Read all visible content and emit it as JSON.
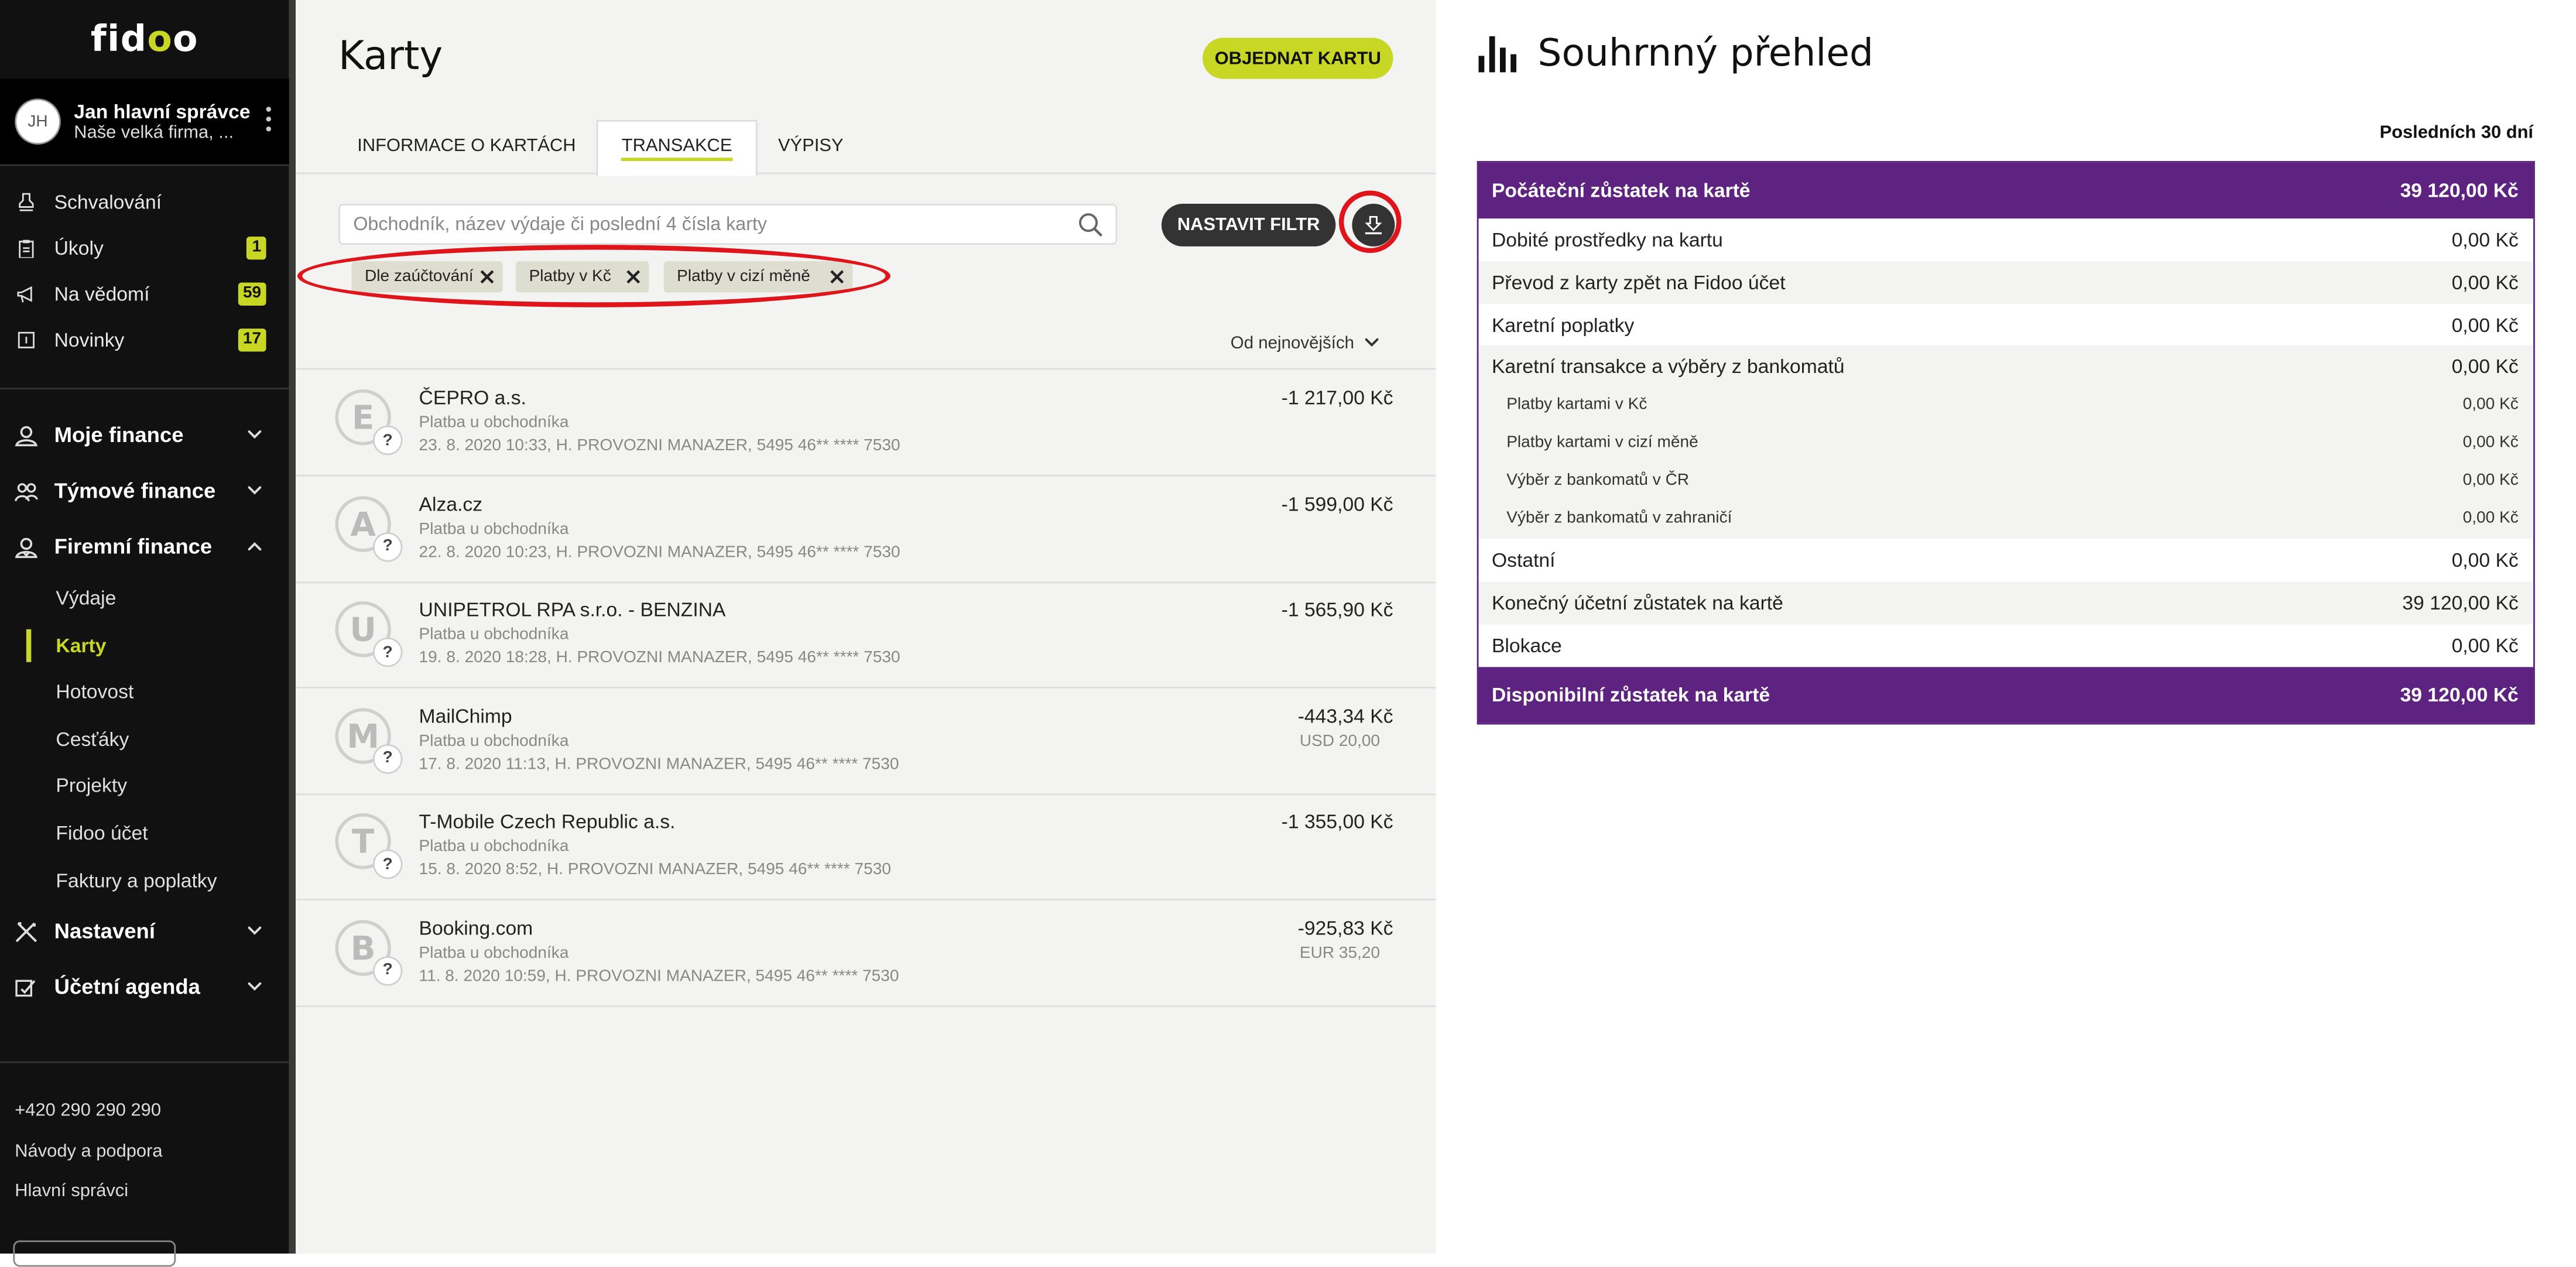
{
  "app": {
    "logo": "fidoo",
    "user_initials": "JH",
    "user_name": "Jan hlavní správce",
    "company": "Naše velká firma, ..."
  },
  "sidebar": {
    "items": [
      {
        "label": "Schvalování",
        "icon": "stamp-icon"
      },
      {
        "label": "Úkoly",
        "icon": "clipboard-icon",
        "badge": "1"
      },
      {
        "label": "Na vědomí",
        "icon": "megaphone-icon",
        "badge": "59"
      },
      {
        "label": "Novinky",
        "icon": "news-icon",
        "badge": "17"
      }
    ],
    "sections": [
      {
        "label": "Moje finance",
        "icon": "person-icon"
      },
      {
        "label": "Týmové finance",
        "icon": "team-icon"
      },
      {
        "label": "Firemní finance",
        "icon": "company-icon"
      }
    ],
    "sub_items": [
      "Výdaje",
      "Karty",
      "Hotovost",
      "Cesťáky",
      "Projekty",
      "Fidoo účet",
      "Faktury a poplatky"
    ],
    "active_sub": "Karty",
    "settings": {
      "label": "Nastavení",
      "icon": "tools-icon"
    },
    "accounting": {
      "label": "Účetní agenda",
      "icon": "accounting-icon"
    },
    "phone": "+420 290 290 290",
    "help": "Návody a podpora",
    "admins": "Hlavní správci"
  },
  "main": {
    "title": "Karty",
    "order_button": "OBJEDNAT KARTU",
    "tabs": [
      {
        "label": "INFORMACE O KARTÁCH"
      },
      {
        "label": "TRANSAKCE",
        "active": true
      },
      {
        "label": "VÝPISY"
      }
    ],
    "search_placeholder": "Obchodník, název výdaje či poslední 4 čísla karty",
    "filter_button": "NASTAVIT FILTR",
    "chips": [
      "Dle zaúčtování",
      "Platby v Kč",
      "Platby v cizí měně"
    ],
    "sort": "Od nejnovějších",
    "transactions": [
      {
        "initial": "E",
        "name": "ČEPRO a.s.",
        "type": "Platba u obchodníka",
        "detail": "23. 8. 2020 10:33, H. PROVOZNI MANAZER, 5495 46** **** 7530",
        "amount": "-1 217,00 Kč",
        "fx": ""
      },
      {
        "initial": "A",
        "name": "Alza.cz",
        "type": "Platba u obchodníka",
        "detail": "22. 8. 2020 10:23, H. PROVOZNI MANAZER, 5495 46** **** 7530",
        "amount": "-1 599,00 Kč",
        "fx": ""
      },
      {
        "initial": "U",
        "name": "UNIPETROL RPA s.r.o. - BENZINA",
        "type": "Platba u obchodníka",
        "detail": "19. 8. 2020 18:28, H. PROVOZNI MANAZER, 5495 46** **** 7530",
        "amount": "-1 565,90 Kč",
        "fx": ""
      },
      {
        "initial": "M",
        "name": "MailChimp",
        "type": "Platba u obchodníka",
        "detail": "17. 8. 2020 11:13, H. PROVOZNI MANAZER, 5495 46** **** 7530",
        "amount": "-443,34 Kč",
        "fx": "USD 20,00"
      },
      {
        "initial": "T",
        "name": "T-Mobile Czech Republic a.s.",
        "type": "Platba u obchodníka",
        "detail": "15. 8. 2020 8:52, H. PROVOZNI MANAZER, 5495 46** **** 7530",
        "amount": "-1 355,00 Kč",
        "fx": ""
      },
      {
        "initial": "B",
        "name": "Booking.com",
        "type": "Platba u obchodníka",
        "detail": "11. 8. 2020 10:59, H. PROVOZNI MANAZER, 5495 46** **** 7530",
        "amount": "-925,83 Kč",
        "fx": "EUR 35,20"
      }
    ]
  },
  "summary": {
    "title": "Souhrnný přehled",
    "period": "Posledních 30 dní",
    "opening": {
      "label": "Počáteční zůstatek na kartě",
      "value": "39 120,00 Kč"
    },
    "lines": [
      {
        "label": "Dobité prostředky na kartu",
        "value": "0,00 Kč",
        "sub": false
      },
      {
        "label": "Převod z karty zpět na Fidoo účet",
        "value": "0,00 Kč",
        "sub": false
      },
      {
        "label": "Karetní poplatky",
        "value": "0,00 Kč",
        "sub": false
      },
      {
        "label": "Karetní transakce a výběry z bankomatů",
        "value": "0,00 Kč",
        "sub": false
      },
      {
        "label": "Platby kartami v Kč",
        "value": "0,00 Kč",
        "sub": true
      },
      {
        "label": "Platby kartami v cizí měně",
        "value": "0,00 Kč",
        "sub": true
      },
      {
        "label": "Výběr z bankomatů v ČR",
        "value": "0,00 Kč",
        "sub": true
      },
      {
        "label": "Výběr z bankomatů v zahraničí",
        "value": "0,00 Kč",
        "sub": true
      },
      {
        "label": "Ostatní",
        "value": "0,00 Kč",
        "sub": false
      },
      {
        "label": "Konečný účetní zůstatek na kartě",
        "value": "39 120,00 Kč",
        "sub": false
      },
      {
        "label": "Blokace",
        "value": "0,00 Kč",
        "sub": false
      }
    ],
    "available": {
      "label": "Disponibilní zůstatek na kartě",
      "value": "39 120,00 Kč"
    }
  },
  "colors": {
    "accent": "#c8d624",
    "purple": "#5e2380",
    "highlight_ring": "#e0141b",
    "sidebar": "#111111"
  }
}
